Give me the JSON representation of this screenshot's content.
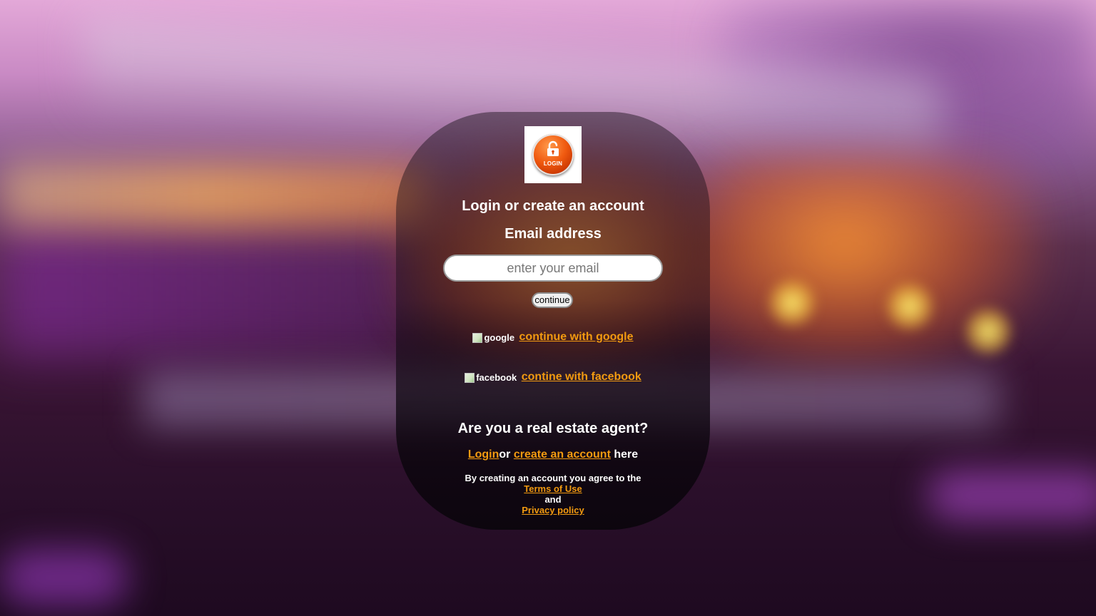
{
  "logo": {
    "icon": "lock-open-icon",
    "text": "LOGIN",
    "accent_color": "#f05a10"
  },
  "form": {
    "heading": "Login or create an account",
    "email_label": "Email address",
    "email_placeholder": "enter your email",
    "email_value": "",
    "continue_label": "continue"
  },
  "social": {
    "google": {
      "img_alt": "google",
      "link_label": "continue with google"
    },
    "facebook": {
      "img_alt": "facebook",
      "link_label": "contine with facebook"
    }
  },
  "agent": {
    "heading": "Are you a real estate agent?",
    "login_link": "Login",
    "or_text": "or",
    "create_link": "create an account",
    "here_text": "here"
  },
  "legal": {
    "intro": "By creating an account you agree to the",
    "terms_link": "Terms of Use",
    "and_text": "and",
    "privacy_link": "Privacy policy"
  },
  "colors": {
    "link": "#f29a10",
    "text": "#ffffff"
  }
}
